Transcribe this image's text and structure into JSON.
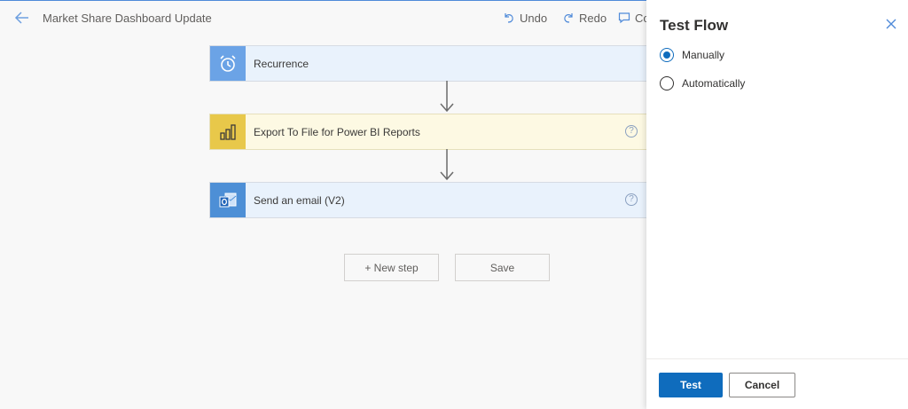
{
  "header": {
    "title": "Market Share Dashboard Update",
    "undo_label": "Undo",
    "redo_label": "Redo",
    "comments_label": "Co",
    "border_color": "#4f8ad9"
  },
  "flow": {
    "steps": [
      {
        "label": "Recurrence",
        "icon": "alarm-clock-icon",
        "accent": "#6ba3e6"
      },
      {
        "label": "Export To File for Power BI Reports",
        "icon": "power-bi-icon",
        "accent": "#e8c84a"
      },
      {
        "label": "Send an email (V2)",
        "icon": "outlook-icon",
        "accent": "#4d8fd6"
      }
    ],
    "new_step_label": "+ New step",
    "save_label": "Save"
  },
  "panel": {
    "title": "Test Flow",
    "options": [
      {
        "label": "Manually",
        "selected": true
      },
      {
        "label": "Automatically",
        "selected": false
      }
    ],
    "test_label": "Test",
    "cancel_label": "Cancel",
    "primary_color": "#0f6cbd"
  }
}
